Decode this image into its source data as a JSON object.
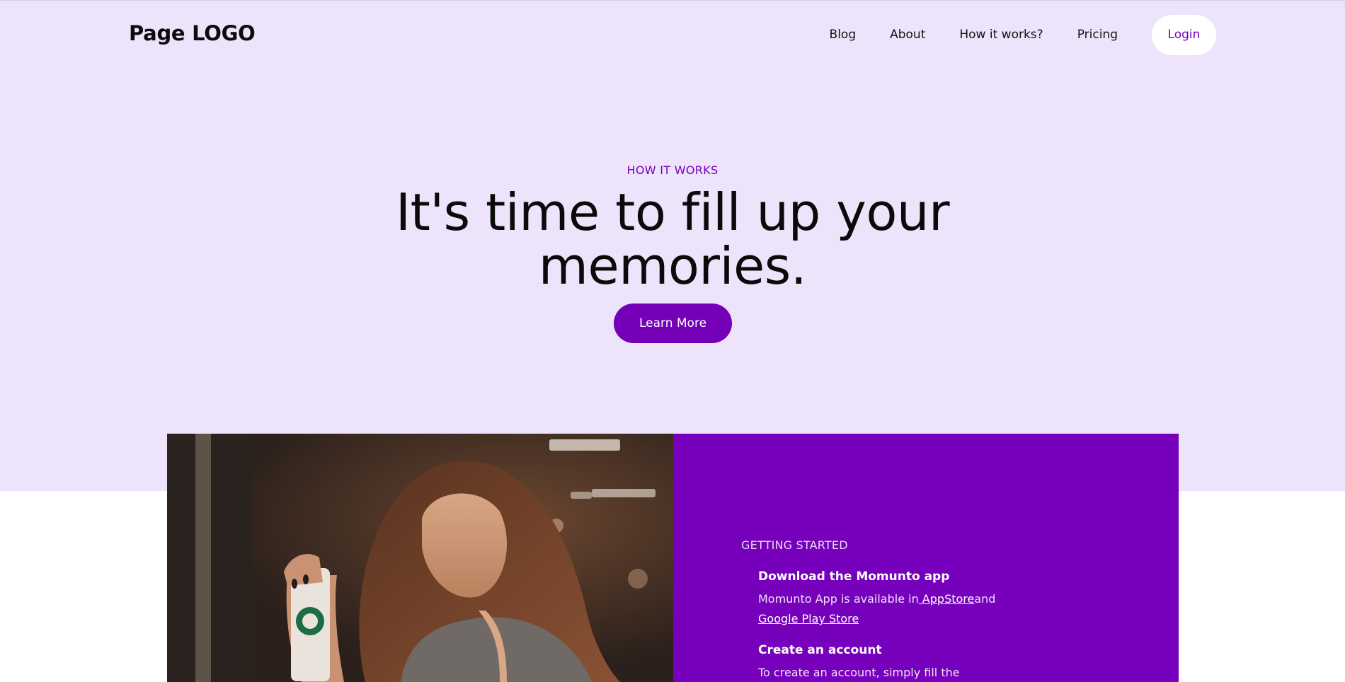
{
  "header": {
    "logo": "Page LOGO",
    "nav": [
      "Blog",
      "About",
      "How it works?",
      "Pricing"
    ],
    "login_label": "Login"
  },
  "hero": {
    "eyebrow": "HOW IT WORKS",
    "headline": "It's time to fill up your memories.",
    "cta_label": "Learn More"
  },
  "getting_started": {
    "title": "GETTING STARTED",
    "step1": {
      "title": "Download the Momunto app",
      "text_before": "Momunto App is available in",
      "link1": " AppStore",
      "text_middle": "and",
      "link2": "Google Play Store"
    },
    "step2": {
      "title": "Create an account",
      "text": "To create an account, simply fill the"
    }
  },
  "colors": {
    "hero_bg": "#ede4fc",
    "accent": "#7600bb",
    "panel_bg": "#7600bb"
  },
  "icons": [
    "woman-with-coffee-photo"
  ]
}
